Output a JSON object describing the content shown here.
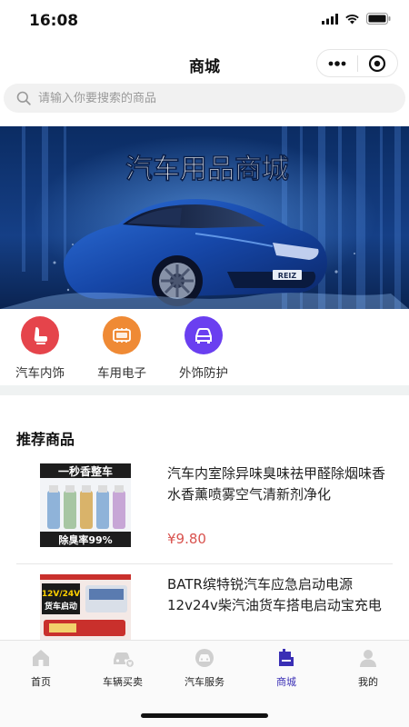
{
  "status_bar": {
    "time": "16:08"
  },
  "nav": {
    "title": "商城"
  },
  "search": {
    "placeholder": "请输入你要搜索的商品"
  },
  "banner": {
    "headline": "汽车用品商城",
    "plate": "REIZ"
  },
  "categories": [
    {
      "label": "汽车内饰",
      "color": "#e5444b",
      "icon": "car-seat-icon"
    },
    {
      "label": "车用电子",
      "color": "#ef8a35",
      "icon": "electronics-icon"
    },
    {
      "label": "外饰防护",
      "color": "#6a3ff0",
      "icon": "car-exterior-icon"
    }
  ],
  "recommend": {
    "title": "推荐商品",
    "products": [
      {
        "name": "汽车内室除异味臭味祛甲醛除烟味香水香薰喷雾空气清新剂净化",
        "price": "¥9.80",
        "image_caption_top": "一秒香整车",
        "image_caption_bottom": "除臭率99%"
      },
      {
        "name": "BATR缤特锐汽车应急启动电源12v24v柴汽油货车搭电启动宝充电",
        "image_caption_top": "12V/24V",
        "image_caption_bottom": "货车启动"
      }
    ]
  },
  "tabbar": {
    "active_color": "#3a2fb5",
    "items": [
      {
        "label": "首页",
        "icon": "home-icon"
      },
      {
        "label": "车辆买卖",
        "icon": "car-trade-icon"
      },
      {
        "label": "汽车服务",
        "icon": "car-service-icon"
      },
      {
        "label": "商城",
        "icon": "mall-icon",
        "active": true
      },
      {
        "label": "我的",
        "icon": "profile-icon"
      }
    ]
  }
}
